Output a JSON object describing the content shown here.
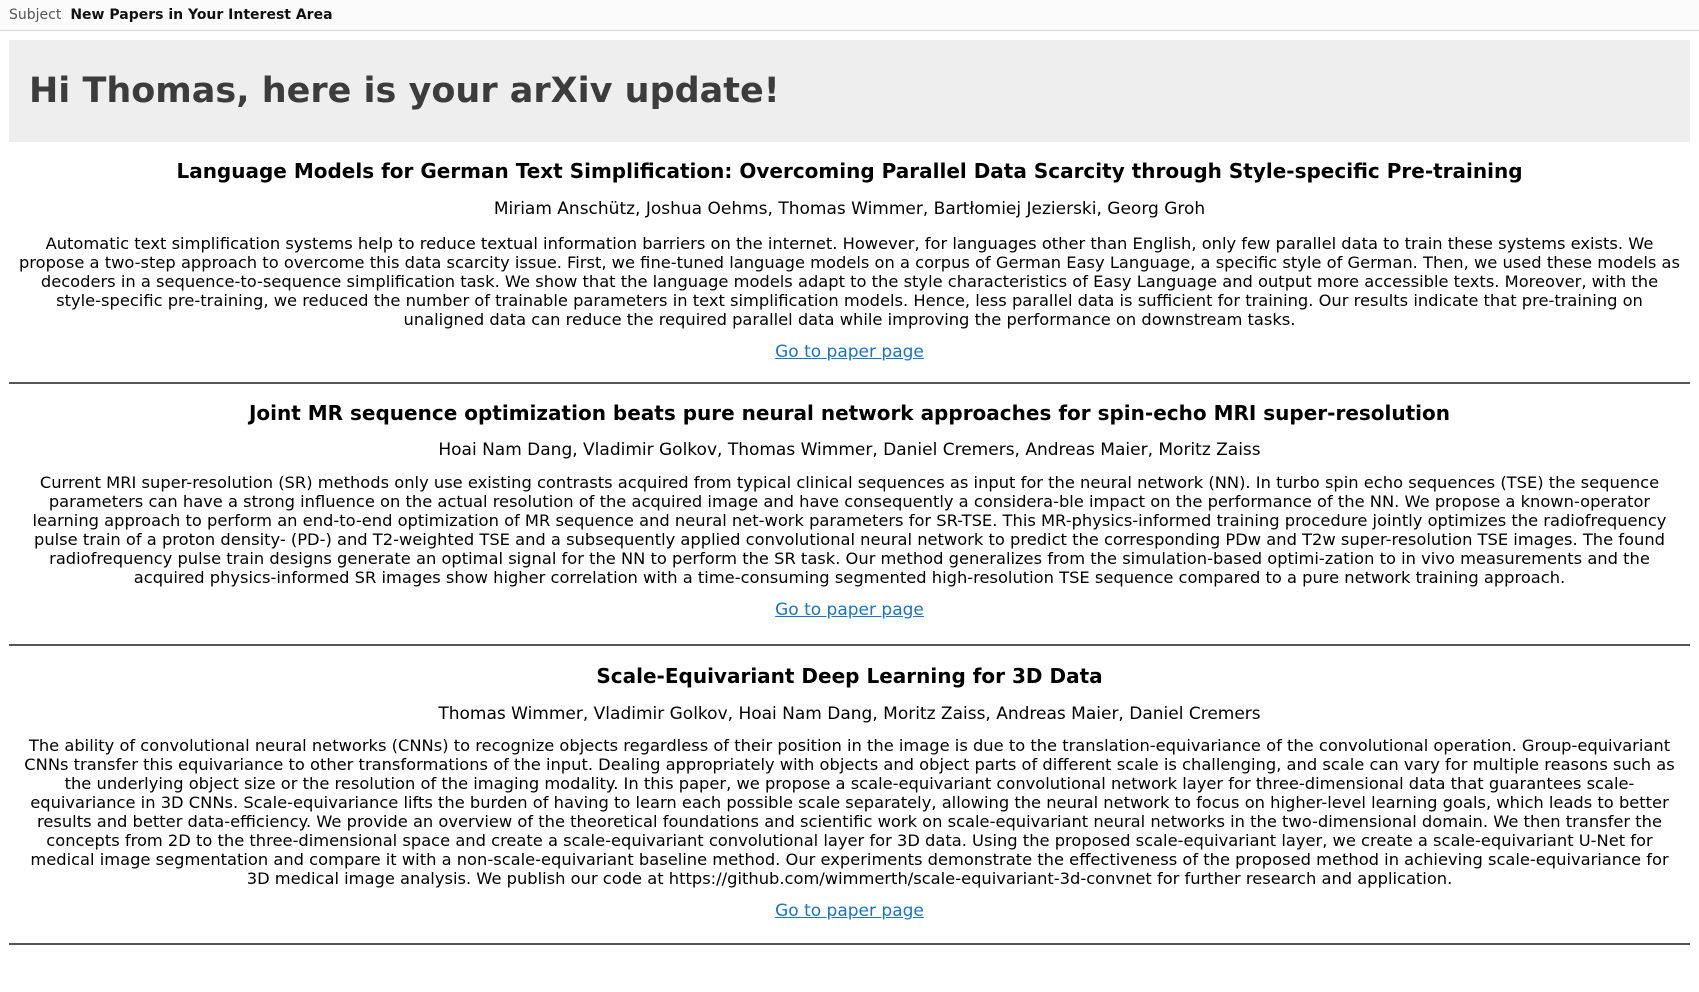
{
  "email": {
    "subject_label": "Subject",
    "subject_value": "New Papers in Your Interest Area"
  },
  "greeting": "Hi Thomas, here is your arXiv update!",
  "papers": [
    {
      "title": "Language Models for German Text Simplification: Overcoming Parallel Data Scarcity through Style-specific Pre-training",
      "authors": "Miriam Anschütz, Joshua Oehms, Thomas Wimmer, Bartłomiej Jezierski, Georg Groh",
      "abstract": "Automatic text simplification systems help to reduce textual information barriers on the internet. However, for languages other than English, only few parallel data to train these systems exists. We propose a two-step approach to overcome this data scarcity issue. First, we fine-tuned language models on a corpus of German Easy Language, a specific style of German. Then, we used these models as decoders in a sequence-to-sequence simplification task. We show that the language models adapt to the style characteristics of Easy Language and output more accessible texts. Moreover, with the style-specific pre-training, we reduced the number of trainable parameters in text simplification models. Hence, less parallel data is sufficient for training. Our results indicate that pre-training on unaligned data can reduce the required parallel data while improving the performance on downstream tasks.",
      "link_text": "Go to paper page"
    },
    {
      "title": "Joint MR sequence optimization beats pure neural network approaches for spin-echo MRI super-resolution",
      "authors": "Hoai Nam Dang, Vladimir Golkov, Thomas Wimmer, Daniel Cremers, Andreas Maier, Moritz Zaiss",
      "abstract": "Current MRI super-resolution (SR) methods only use existing contrasts acquired from typical clinical sequences as input for the neural network (NN). In turbo spin echo sequences (TSE) the sequence parameters can have a strong influence on the actual resolution of the acquired image and have consequently a considera-ble impact on the performance of the NN. We propose a known-operator learning approach to perform an end-to-end optimization of MR sequence and neural net-work parameters for SR-TSE. This MR-physics-informed training procedure jointly optimizes the radiofrequency pulse train of a proton density- (PD-) and T2-weighted TSE and a subsequently applied convolutional neural network to predict the corresponding PDw and T2w super-resolution TSE images. The found radiofrequency pulse train designs generate an optimal signal for the NN to perform the SR task. Our method generalizes from the simulation-based optimi-zation to in vivo measurements and the acquired physics-informed SR images show higher correlation with a time-consuming segmented high-resolution TSE sequence compared to a pure network training approach.",
      "link_text": "Go to paper page"
    },
    {
      "title": "Scale-Equivariant Deep Learning for 3D Data",
      "authors": "Thomas Wimmer, Vladimir Golkov, Hoai Nam Dang, Moritz Zaiss, Andreas Maier, Daniel Cremers",
      "abstract": "The ability of convolutional neural networks (CNNs) to recognize objects regardless of their position in the image is due to the translation-equivariance of the convolutional operation. Group-equivariant CNNs transfer this equivariance to other transformations of the input. Dealing appropriately with objects and object parts of different scale is challenging, and scale can vary for multiple reasons such as the underlying object size or the resolution of the imaging modality. In this paper, we propose a scale-equivariant convolutional network layer for three-dimensional data that guarantees scale-equivariance in 3D CNNs. Scale-equivariance lifts the burden of having to learn each possible scale separately, allowing the neural network to focus on higher-level learning goals, which leads to better results and better data-efficiency. We provide an overview of the theoretical foundations and scientific work on scale-equivariant neural networks in the two-dimensional domain. We then transfer the concepts from 2D to the three-dimensional space and create a scale-equivariant convolutional layer for 3D data. Using the proposed scale-equivariant layer, we create a scale-equivariant U-Net for medical image segmentation and compare it with a non-scale-equivariant baseline method. Our experiments demonstrate the effectiveness of the proposed method in achieving scale-equivariance for 3D medical image analysis. We publish our code at https://github.com/wimmerth/scale-equivariant-3d-convnet for further research and application.",
      "link_text": "Go to paper page"
    }
  ]
}
